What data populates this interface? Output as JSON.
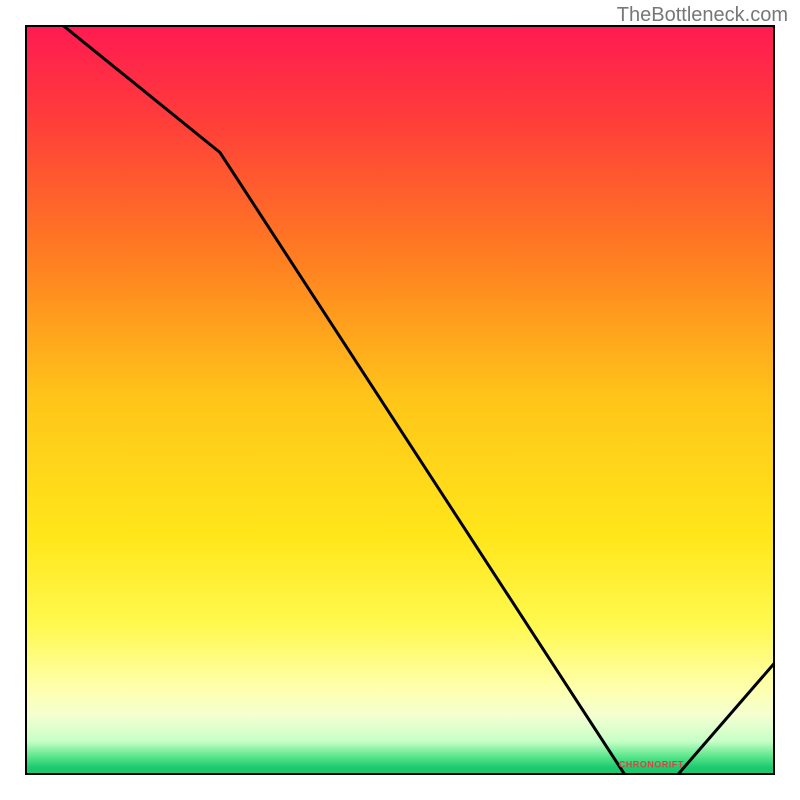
{
  "watermark": "TheBottleneck.com",
  "chart_data": {
    "type": "line",
    "title": "",
    "xlabel": "",
    "ylabel": "",
    "xlim": [
      0,
      100
    ],
    "ylim": [
      0,
      100
    ],
    "x": [
      0,
      5,
      26,
      80,
      87,
      100
    ],
    "values": [
      105,
      100,
      83,
      0,
      0,
      15
    ],
    "annotation": {
      "x": 83.5,
      "y": 1,
      "text": "CHRONORIFT",
      "color": "#d64545"
    },
    "background_gradient_stops": [
      {
        "offset": 0.0,
        "color": "#ff1a52"
      },
      {
        "offset": 0.12,
        "color": "#ff3b3b"
      },
      {
        "offset": 0.3,
        "color": "#ff7a22"
      },
      {
        "offset": 0.5,
        "color": "#ffc619"
      },
      {
        "offset": 0.68,
        "color": "#ffe61a"
      },
      {
        "offset": 0.8,
        "color": "#fff94f"
      },
      {
        "offset": 0.88,
        "color": "#ffffa8"
      },
      {
        "offset": 0.92,
        "color": "#f5ffd0"
      },
      {
        "offset": 0.955,
        "color": "#c7ffc7"
      },
      {
        "offset": 0.975,
        "color": "#5ce68c"
      },
      {
        "offset": 0.99,
        "color": "#1dc96f"
      },
      {
        "offset": 1.0,
        "color": "#1dc96f"
      }
    ],
    "line_color": "#000000",
    "frame_color": "#000000"
  }
}
